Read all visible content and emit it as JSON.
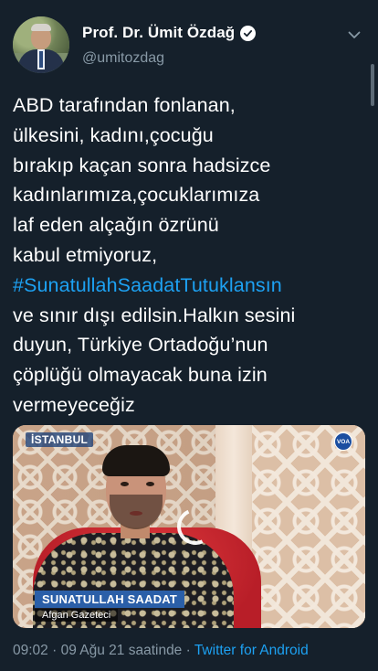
{
  "user": {
    "display_name": "Prof. Dr. Ümit Özdağ",
    "handle": "@umitozdag",
    "verified": true
  },
  "tweet": {
    "lines": [
      "ABD tarafından fonlanan,",
      "ülkesini, kadını,çocuğu",
      "bırakıp kaçan sonra hadsizce",
      "kadınlarımıza,çocuklarımıza",
      "laf eden alçağın özrünü",
      "kabul etmiyoruz,",
      "#SunatullahSaadatTutuklansın",
      "ve sınır dışı edilsin.Halkın sesini",
      "duyun, Türkiye Ortadoğu’nun",
      "çöplüğü olmayacak buna izin",
      "vermeyeceğiz"
    ]
  },
  "media": {
    "location_tag": "İSTANBUL",
    "logo_text": "VOA",
    "caption_name": "SUNATULLAH SAADAT",
    "caption_title": "Afgan Gazeteci"
  },
  "meta": {
    "time": "09:02",
    "separator": " · ",
    "date": "09 Ağu 21 saatinde",
    "source": "Twitter for Android"
  },
  "colors": {
    "background": "#15202b",
    "link": "#1da1f2",
    "secondary_text": "#8899a6"
  },
  "icons": {
    "verified": "verified-badge-icon",
    "menu": "chevron-down-icon"
  }
}
